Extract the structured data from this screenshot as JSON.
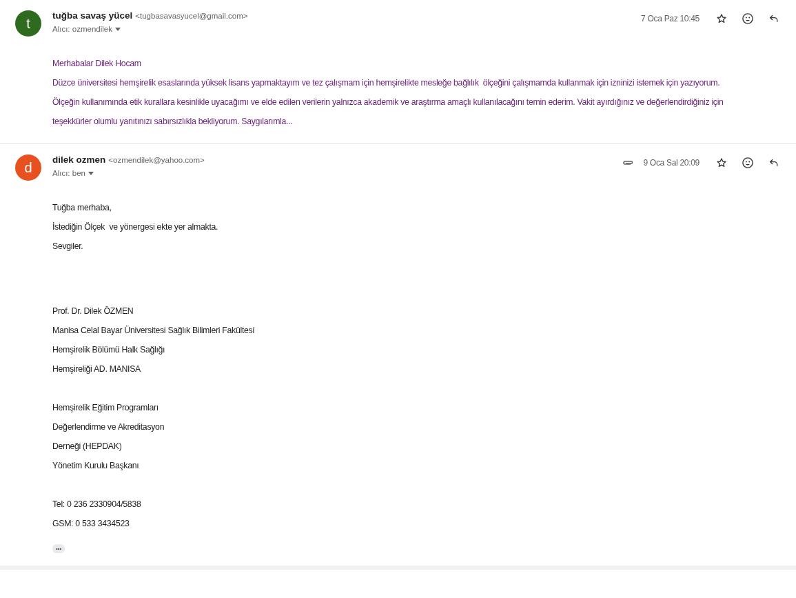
{
  "messages": [
    {
      "initial": "t",
      "color": "#2e6b1f",
      "sender": "tuğba savaş yücel",
      "email": "<tugbasavasyucel@gmail.com>",
      "recipient": "Alıcı: ozmendilek",
      "date": "7 Oca Paz 10:45",
      "attachment": false,
      "starred": false,
      "kind": "quoted",
      "body": [
        [
          "Merhabalar Dilek Hocam",
          "Düzce üniversitesi hemşirelik esaslarında yüksek lisans yapmaktayım ve tez çalışmam için hemşirelikte mesleğe bağlılık  ölçeğini çalışmamda kullanmak için izninizi istemek için yazıyorum.",
          "Ölçeğin kullanımında etik kurallara kesinlikle uyacağımı ve elde edilen verilerin yalnızca akademik ve araştırma amaçlı kullanılacağını temin ederim. Vakit ayırdığınız ve değerlendirdiğiniz için",
          "teşekkürler olumlu yanıtınızı sabırsızlıkla bekliyorum. Saygılarımla..."
        ]
      ]
    },
    {
      "initial": "d",
      "color": "#e8511f",
      "sender": "dilek ozmen",
      "email": "<ozmendilek@yahoo.com>",
      "recipient": "Alıcı: ben",
      "date": "9 Oca Sal 20:09",
      "attachment": true,
      "starred": false,
      "kind": "plain",
      "body": [
        [
          "Tuğba merhaba,",
          "İstediğin Ölçek  ve yönergesi ekte yer almakta.",
          "Sevgiler."
        ]
      ],
      "signature": [
        [
          "Prof. Dr. Dilek ÖZMEN",
          "Manisa Celal Bayar Üniversitesi Sağlık Bilimleri Fakültesi",
          "Hemşirelik Bölümü Halk Sağlığı",
          "Hemşireliği AD. MANISA"
        ],
        [
          "Hemşirelik Eğitim Programları",
          "Değerlendirme ve Akreditasyon",
          "Derneği (HEPDAK)",
          "Yönetim Kurulu Başkanı"
        ],
        [
          "Tel: 0 236 2330904/5838",
          "GSM: 0 533 3434523"
        ]
      ],
      "more": "•••"
    }
  ]
}
